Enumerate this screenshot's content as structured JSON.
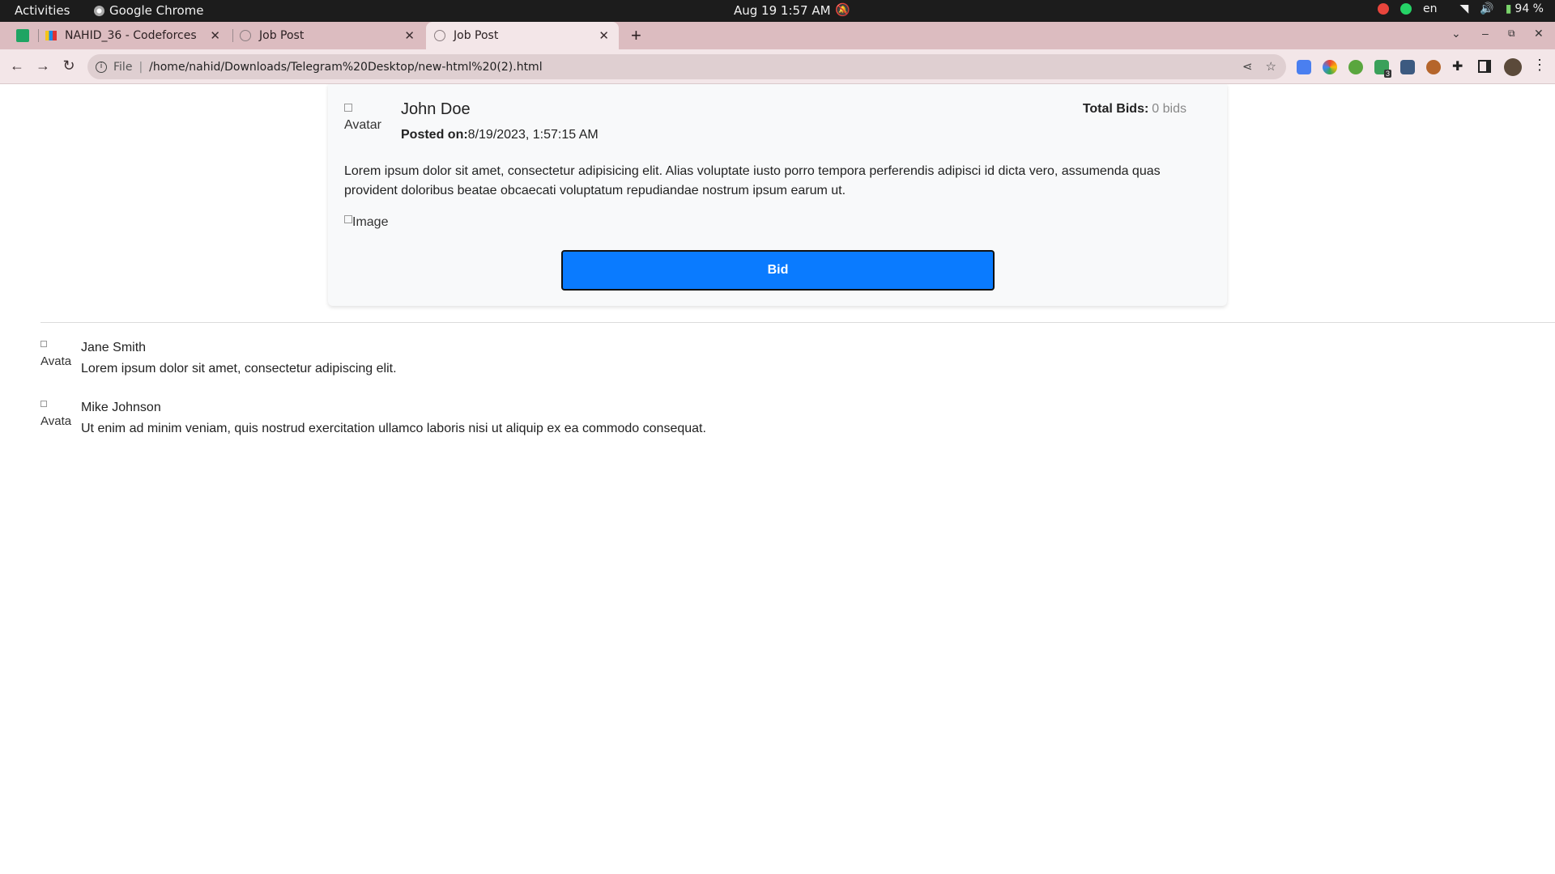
{
  "system_bar": {
    "activities": "Activities",
    "app_name": "Google Chrome",
    "clock": "Aug 19  1:57 AM",
    "language": "en",
    "battery": "94 %"
  },
  "browser": {
    "tabs": [
      {
        "label": "NAHID_36 - Codeforces"
      },
      {
        "label": "Job Post"
      },
      {
        "label": "Job Post"
      }
    ],
    "new_tab": "+",
    "address": {
      "scheme": "File",
      "url": "/home/nahid/Downloads/Telegram%20Desktop/new-html%20(2).html"
    },
    "extension_badge": "3"
  },
  "post": {
    "avatar_alt": "Avatar",
    "author": "John Doe",
    "posted_label": "Posted on:",
    "posted_value": "8/19/2023, 1:57:15 AM",
    "total_bids_label": "Total Bids:",
    "total_bids_value": "0 bids",
    "description": "Lorem ipsum dolor sit amet, consectetur adipisicing elit. Alias voluptate iusto porro tempora perferendis adipisci id dicta vero, assumenda quas provident doloribus beatae obcaecati voluptatum repudiandae nostrum ipsum earum ut.",
    "image_alt": "Image",
    "bid_button": "Bid",
    "accent_color": "#0a7bff"
  },
  "comments": [
    {
      "avatar_alt": "Avata",
      "name": "Jane Smith",
      "text": "Lorem ipsum dolor sit amet, consectetur adipiscing elit."
    },
    {
      "avatar_alt": "Avata",
      "name": "Mike Johnson",
      "text": "Ut enim ad minim veniam, quis nostrud exercitation ullamco laboris nisi ut aliquip ex ea commodo consequat."
    }
  ]
}
